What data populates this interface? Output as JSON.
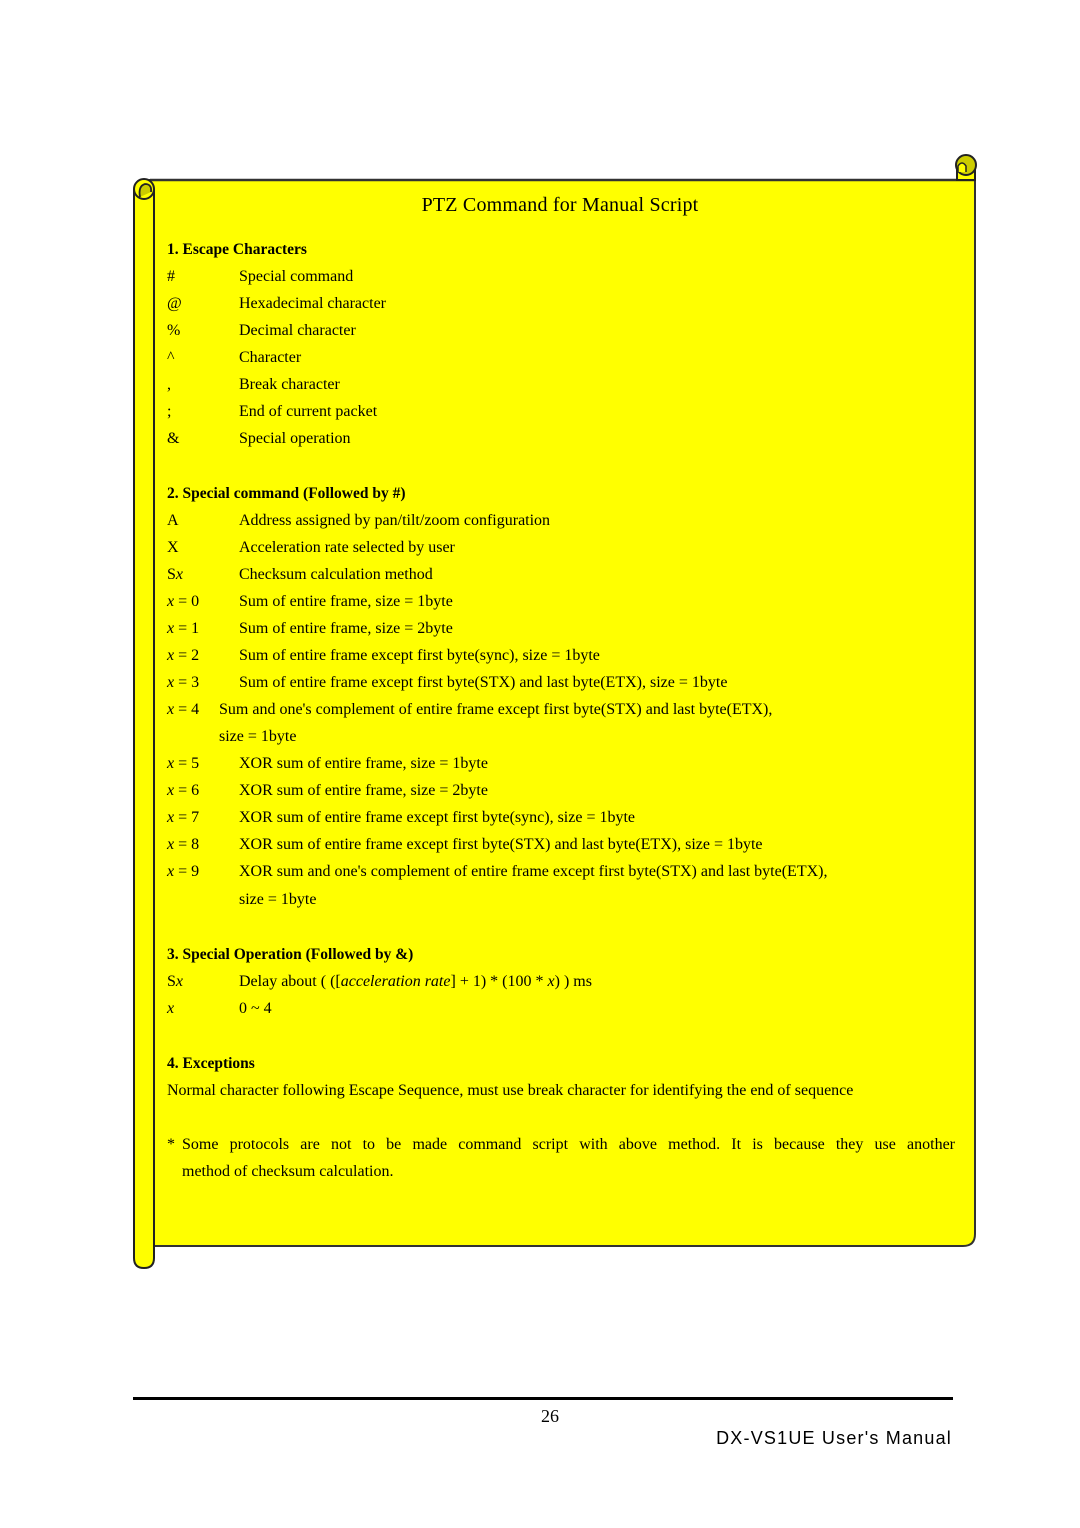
{
  "page": {
    "title": "PTZ Command for Manual Script",
    "background_color": "#FFFF00",
    "roll_shade_color": "#CCCC00"
  },
  "sections": [
    {
      "heading": "1. Escape Characters",
      "rows": [
        {
          "key": "#",
          "desc": "Special command"
        },
        {
          "key": "@",
          "desc": "Hexadecimal character"
        },
        {
          "key": "%",
          "desc": "Decimal character"
        },
        {
          "key": "^",
          "desc": "Character"
        },
        {
          "key": ",",
          "desc": "Break character"
        },
        {
          "key": ";",
          "desc": "End of current packet"
        },
        {
          "key": "&",
          "desc": "Special operation"
        }
      ]
    },
    {
      "heading": "2. Special command (Followed by #)",
      "rows": [
        {
          "key": "A",
          "desc": "Address assigned by pan/tilt/zoom configuration"
        },
        {
          "key": "X",
          "desc": "Acceleration rate selected by user"
        },
        {
          "key_prefix": "S",
          "key_var": "x",
          "desc": "Checksum calculation method"
        },
        {
          "key_var": "x",
          "key_suffix": " = 0",
          "desc": "Sum of entire frame, size = 1byte"
        },
        {
          "key_var": "x",
          "key_suffix": " = 1",
          "desc": "Sum of entire frame, size = 2byte"
        },
        {
          "key_var": "x",
          "key_suffix": " = 2",
          "desc": "Sum of entire frame except first byte(sync), size = 1byte"
        },
        {
          "key_var": "x",
          "key_suffix": " = 3",
          "desc": "Sum of entire frame except first byte(STX) and last byte(ETX), size = 1byte"
        },
        {
          "key_var": "x",
          "key_suffix": " = 4",
          "desc": "Sum and one's complement of entire frame except first byte(STX) and last byte(ETX),",
          "desc_cont": "size = 1byte"
        },
        {
          "key_var": "x",
          "key_suffix": " = 5",
          "desc": "XOR sum of entire frame, size = 1byte"
        },
        {
          "key_var": "x",
          "key_suffix": " = 6",
          "desc": "XOR sum of entire frame, size = 2byte"
        },
        {
          "key_var": "x",
          "key_suffix": " = 7",
          "desc": "XOR sum of entire frame except first byte(sync), size = 1byte"
        },
        {
          "key_var": "x",
          "key_suffix": " = 8",
          "desc": "XOR sum of entire frame except first byte(STX) and last byte(ETX), size = 1byte"
        },
        {
          "key_var": "x",
          "key_suffix": " = 9",
          "desc": "XOR sum and one's complement of entire frame except first byte(STX) and last byte(ETX),",
          "desc_cont": "size = 1byte"
        }
      ]
    },
    {
      "heading": "3. Special Operation (Followed by &)",
      "rows": [
        {
          "key_prefix": "S",
          "key_var": "x",
          "desc_a": "Delay about ( ([",
          "desc_italic": "acceleration rate",
          "desc_b": "] + 1) * (100 * ",
          "desc_var": "x",
          "desc_c": ") ) ms"
        },
        {
          "key_var": "x",
          "desc": "0 ~ 4"
        }
      ]
    },
    {
      "heading": "4. Exceptions",
      "text": "Normal character following Escape Sequence, must use break character for identifying the end of sequence"
    }
  ],
  "note": {
    "marker": "*",
    "line1": "Some protocols are not to be made command script with above method. It is because they use another",
    "line2": "method of checksum calculation."
  },
  "footer": {
    "page_number": "26",
    "manual_title": "DX-VS1UE User's Manual"
  }
}
